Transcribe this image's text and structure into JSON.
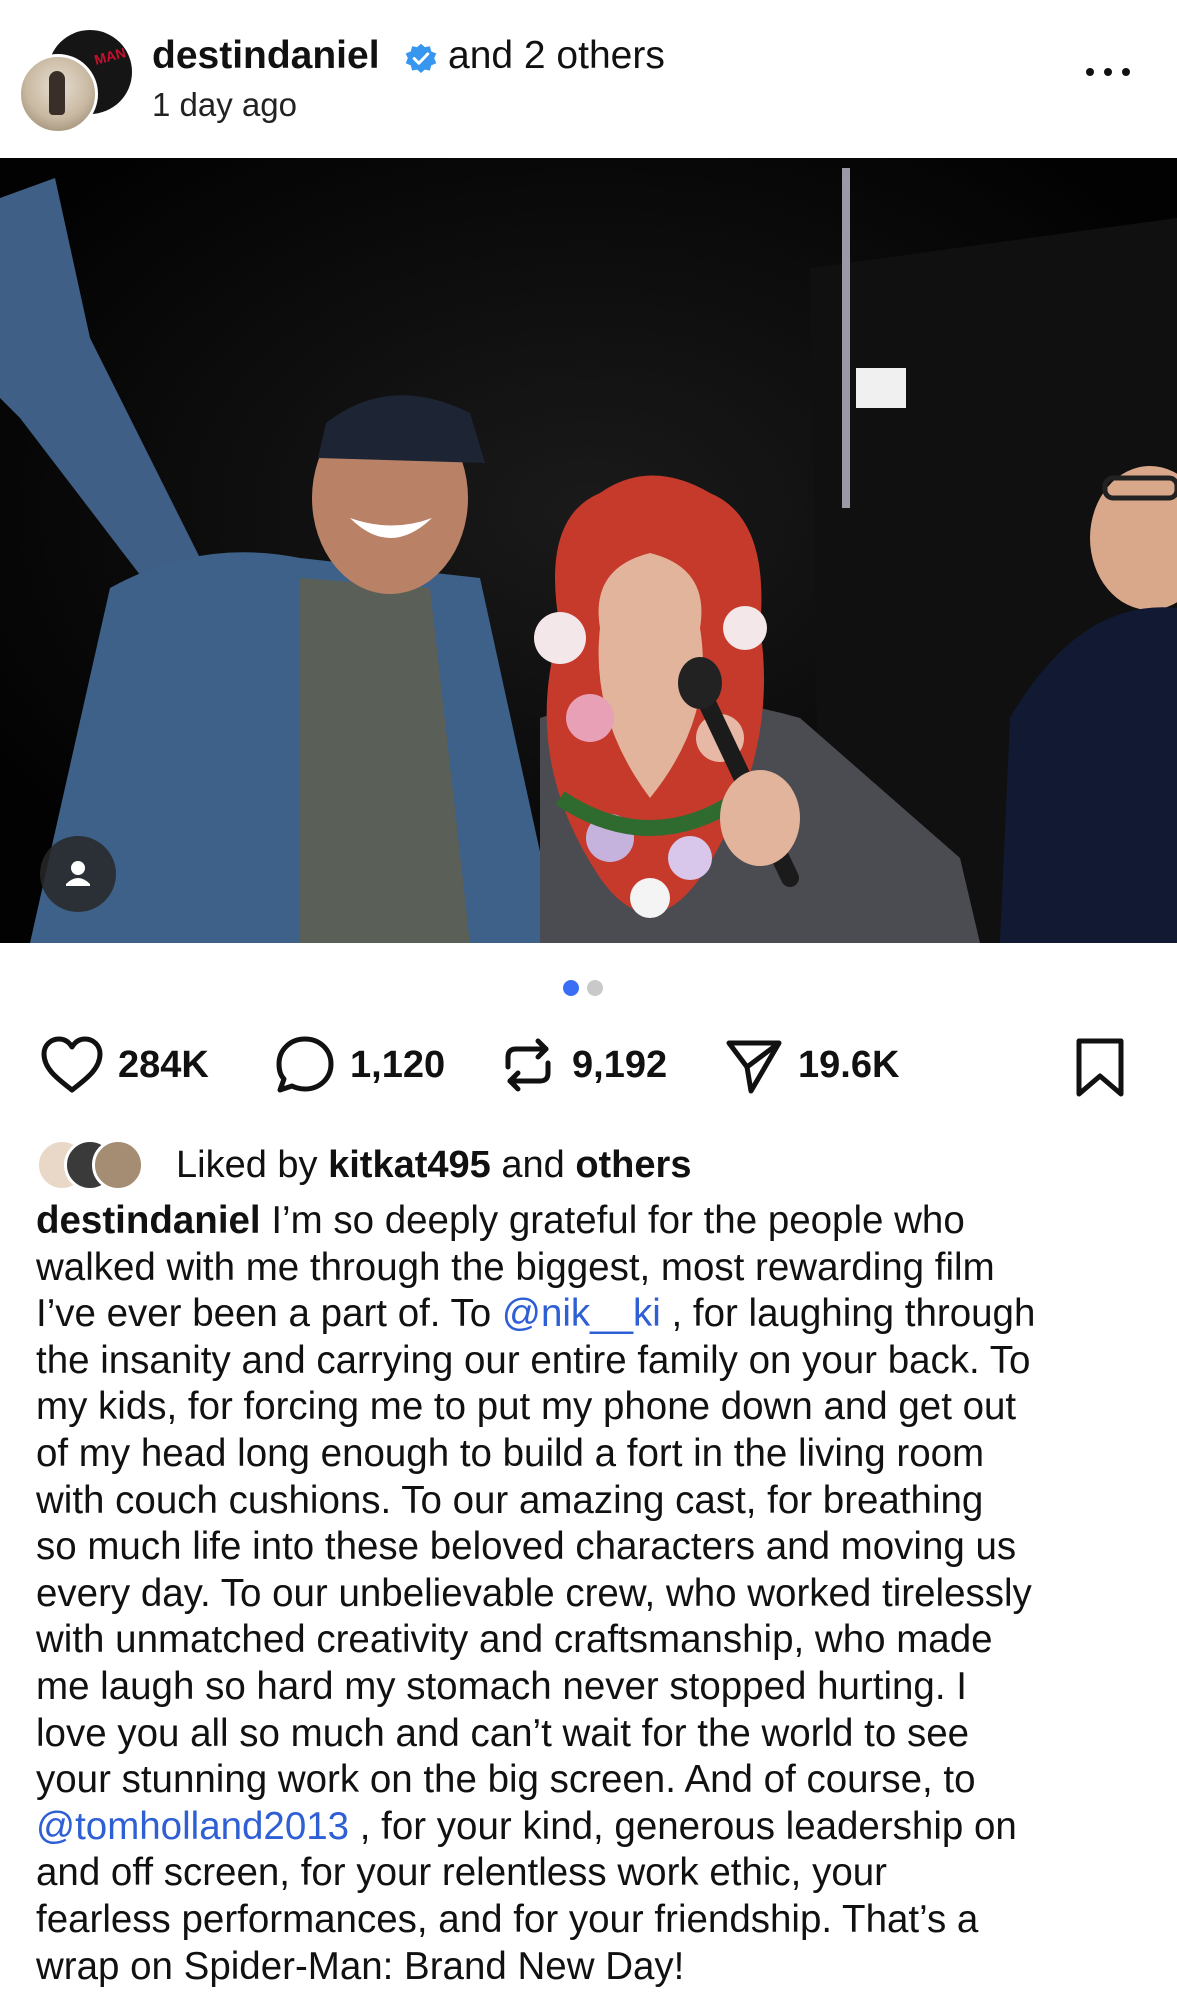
{
  "header": {
    "username": "destindaniel",
    "coauthors": "and 2 others",
    "time": "1 day ago",
    "avatar_tag": "MAN"
  },
  "post": {
    "carousel": {
      "total": 2,
      "active": 1
    },
    "colors": {
      "accent": "#3a6ef5",
      "mention": "#2f5fd4",
      "verified": "#3797f0"
    }
  },
  "actions": {
    "likes": "284K",
    "comments": "1,120",
    "reposts": "9,192",
    "shares": "19.6K"
  },
  "liked_by": {
    "prefix": "Liked by",
    "user": "kitkat495",
    "conjunction": "and",
    "rest": "others"
  },
  "caption": {
    "author": "destindaniel",
    "lines": [
      [
        {
          "t": "author",
          "text": "destindaniel"
        },
        {
          "t": "text",
          "text": " I’m so deeply grateful for the people who"
        }
      ],
      [
        {
          "t": "text",
          "text": "walked with me through the biggest, most rewarding film"
        }
      ],
      [
        {
          "t": "text",
          "text": "I’ve ever been a part of. To "
        },
        {
          "t": "mention",
          "text": "@nik__ki"
        },
        {
          "t": "text",
          "text": " , for laughing through"
        }
      ],
      [
        {
          "t": "text",
          "text": "the insanity and carrying our entire family on your back. To"
        }
      ],
      [
        {
          "t": "text",
          "text": "my kids, for forcing me to put my phone down and get out"
        }
      ],
      [
        {
          "t": "text",
          "text": "of my head long enough to build a fort in the living room"
        }
      ],
      [
        {
          "t": "text",
          "text": "with couch cushions. To our amazing cast, for breathing"
        }
      ],
      [
        {
          "t": "text",
          "text": "so much life into these beloved characters and moving us"
        }
      ],
      [
        {
          "t": "text",
          "text": "every day. To our unbelievable crew, who worked tirelessly"
        }
      ],
      [
        {
          "t": "text",
          "text": "with unmatched creativity and craftsmanship, who made"
        }
      ],
      [
        {
          "t": "text",
          "text": "me laugh so hard my stomach never stopped hurting. I"
        }
      ],
      [
        {
          "t": "text",
          "text": "love you all so much and can’t wait for the world to see"
        }
      ],
      [
        {
          "t": "text",
          "text": "your stunning work on the big screen. And of course, to"
        }
      ],
      [
        {
          "t": "mention",
          "text": "@tomholland2013"
        },
        {
          "t": "text",
          "text": " , for your kind, generous leadership on"
        }
      ],
      [
        {
          "t": "text",
          "text": "and off screen, for your relentless work ethic, your"
        }
      ],
      [
        {
          "t": "text",
          "text": "fearless performances, and for your friendship. That’s a"
        }
      ],
      [
        {
          "t": "text",
          "text": "wrap on Spider-Man: Brand New Day!"
        }
      ]
    ]
  }
}
